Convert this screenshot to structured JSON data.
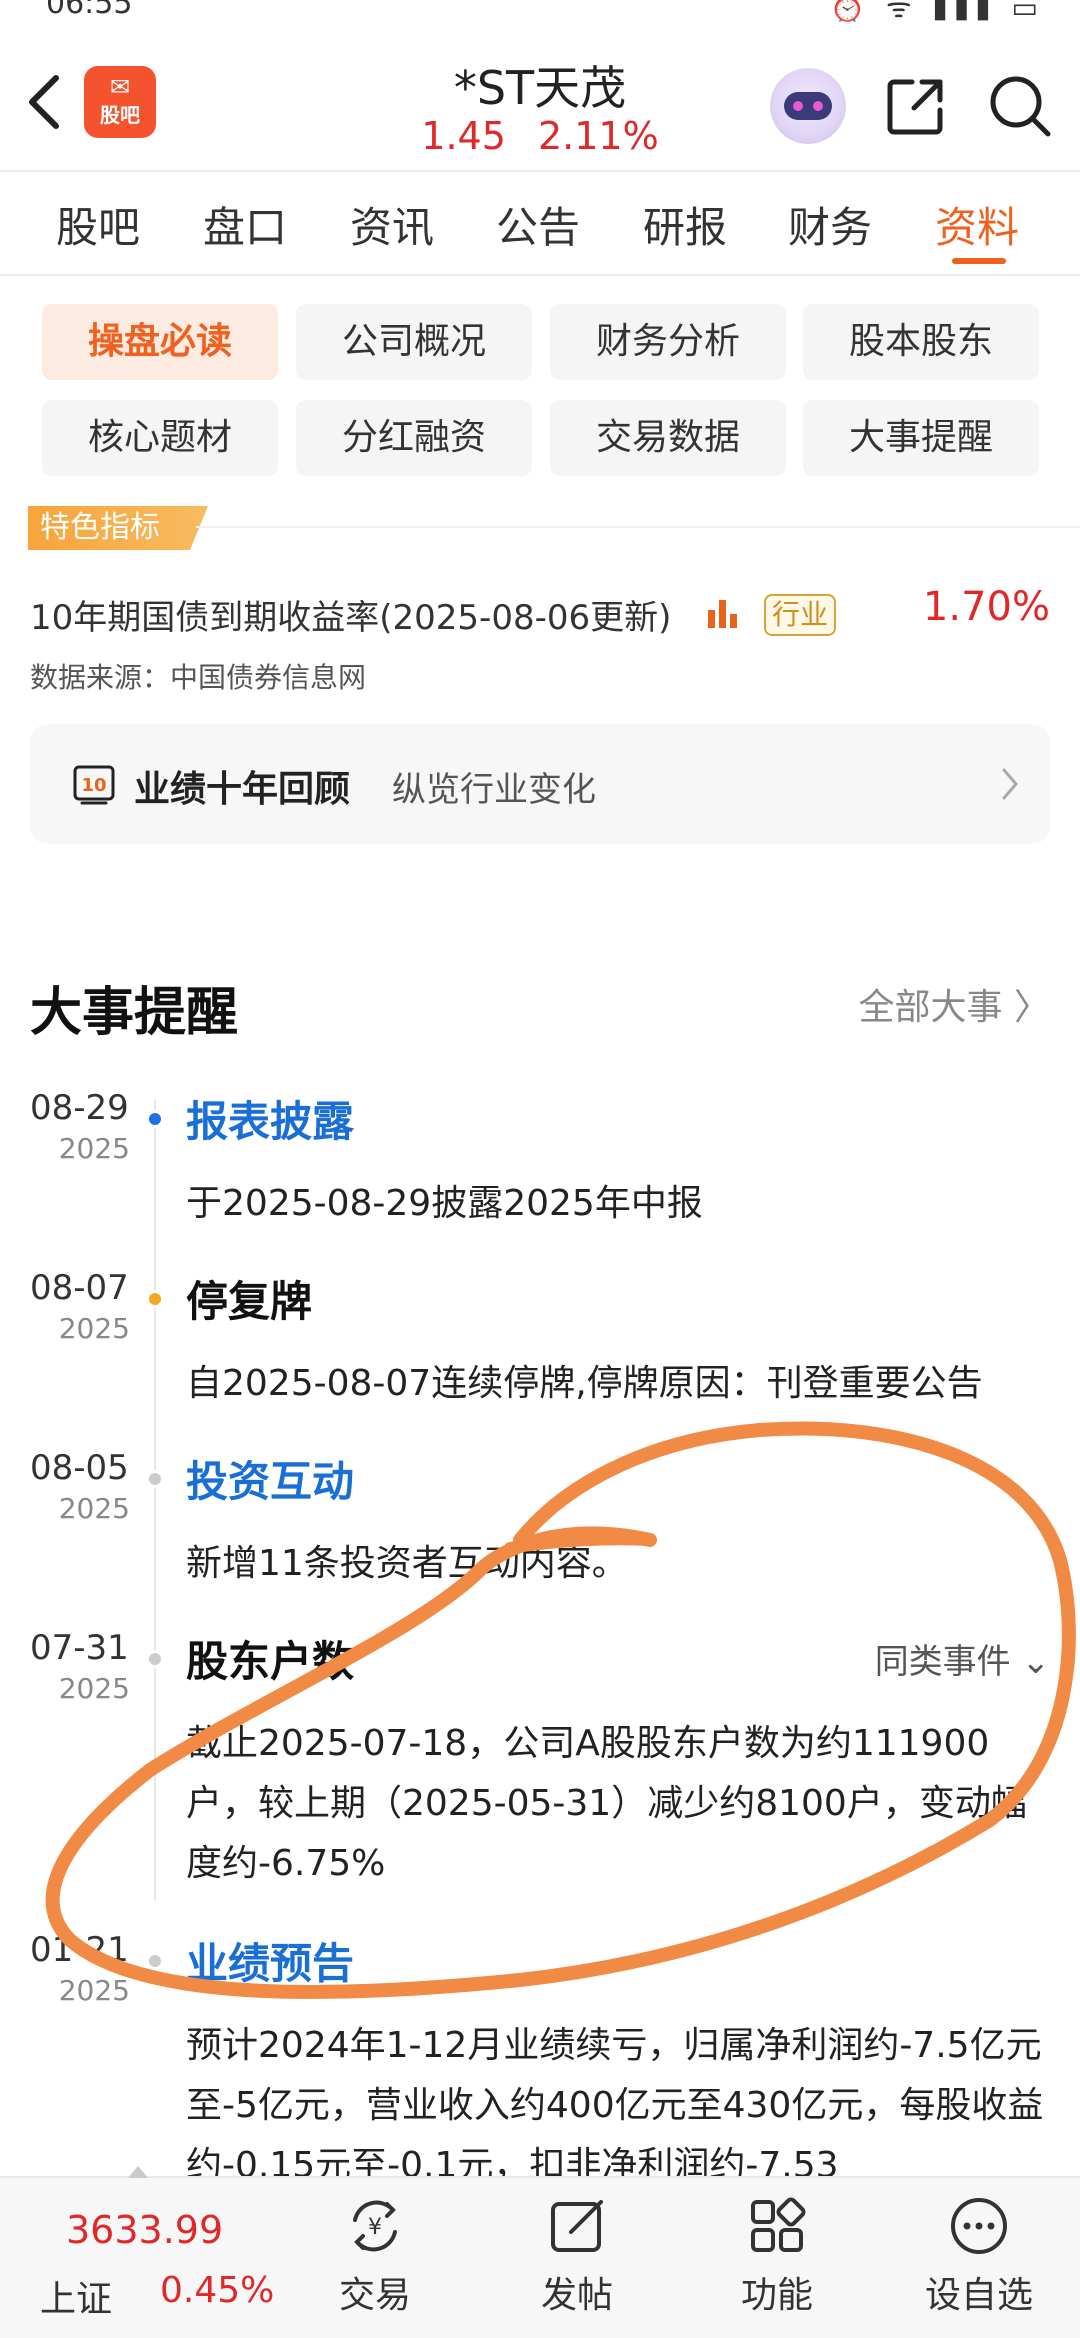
{
  "status": {
    "time": "06:55",
    "icons": "⏰ ᯤ ▮▮▮ ▭"
  },
  "header": {
    "logo_text": "股吧",
    "stock_name": "*ST天茂",
    "price": "1.45",
    "change": "2.11%"
  },
  "tabs": [
    "股吧",
    "盘口",
    "资讯",
    "公告",
    "研报",
    "财务",
    "资料"
  ],
  "active_tab": "资料",
  "chips": [
    "操盘必读",
    "公司概况",
    "财务分析",
    "股本股东",
    "核心题材",
    "分红融资",
    "交易数据",
    "大事提醒"
  ],
  "active_chip": "操盘必读",
  "featured": {
    "badge": "特色指标",
    "indicator_name": "10年期国债到期收益率(2025-08-06更新)",
    "industry_tag": "行业",
    "value": "1.70%",
    "source": "数据来源：中国债券信息网"
  },
  "review": {
    "icon_text": "10",
    "title": "业绩十年回顾",
    "subtitle": "纵览行业变化"
  },
  "events_section": {
    "title": "大事提醒",
    "all_link": "全部大事",
    "similar_link": "同类事件",
    "events": [
      {
        "date": "08-29",
        "year": "2025",
        "title": "报表披露",
        "desc": "于2025-08-29披露2025年中报"
      },
      {
        "date": "08-07",
        "year": "2025",
        "title": "停复牌",
        "desc": "自2025-08-07连续停牌,停牌原因：刊登重要公告"
      },
      {
        "date": "08-05",
        "year": "2025",
        "title": "投资互动",
        "desc": "新增11条投资者互动内容。"
      },
      {
        "date": "07-31",
        "year": "2025",
        "title": "股东户数",
        "desc": "截止2025-07-18，公司A股股东户数为约111900户，较上期（2025-05-31）减少约8100户，变动幅度约-6.75%"
      },
      {
        "date": "01-21",
        "year": "2025",
        "title": "业绩预告",
        "desc": "预计2024年1-12月业绩续亏，归属净利润约-7.5亿元至-5亿元，营业收入约400亿元至430亿元，每股收益约-0.15元至-0.1元，扣非净利润约-7.53"
      }
    ]
  },
  "bottom": {
    "index_value": "3633.99",
    "index_name": "上证",
    "index_change": "0.45%",
    "nav": [
      "交易",
      "发帖",
      "功能",
      "设自选"
    ]
  },
  "colors": {
    "accent": "#f0601e",
    "up_red": "#e02828",
    "link_blue": "#1a6fd6",
    "scribble": "#f08a45"
  }
}
